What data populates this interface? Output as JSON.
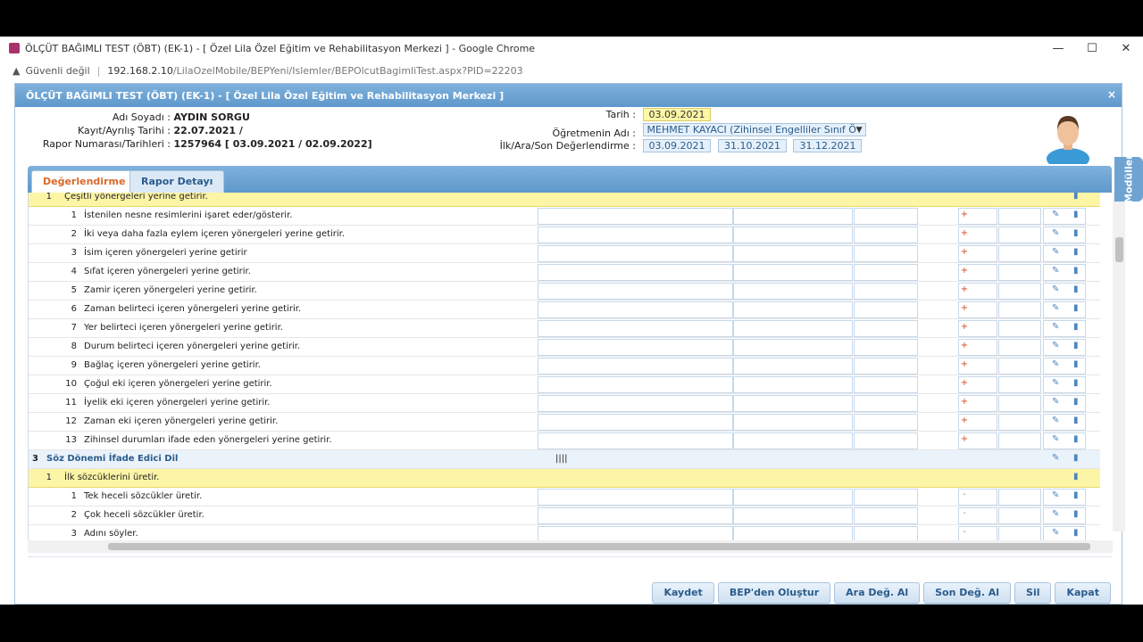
{
  "browser": {
    "window_title": "ÖLÇÜT BAĞIMLI TEST (ÖBT) (EK-1) - [ Özel Lila Özel Eğitim ve Rehabilitasyon Merkezi ] - Google Chrome",
    "security_label": "Güvenli değil",
    "url_host": "192.168.2.10",
    "url_path": "/LilaOzelMobile/BEPYeni/Islemler/BEPOlcutBagimliTest.aspx?PID=22203",
    "minimize": "—",
    "maximize": "☐",
    "close": "✕"
  },
  "modal": {
    "title": "ÖLÇÜT BAĞIMLI TEST (ÖBT) (EK-1) - [ Özel Lila Özel Eğitim ve Rehabilitasyon Merkezi ]",
    "close": "×"
  },
  "info": {
    "name_label": "Adı Soyadı :",
    "name_value": "AYDIN SORGU",
    "reg_label": "Kayıt/Ayrılış Tarihi :",
    "reg_value": "22.07.2021 /",
    "report_label": "Rapor Numarası/Tarihleri :",
    "report_value": "1257964 [ 03.09.2021 / 02.09.2022]",
    "date_label": "Tarih :",
    "date_value": "03.09.2021",
    "teacher_label": "Öğretmenin Adı :",
    "teacher_value": "MEHMET KAYACI (Zihinsel Engelliler Sınıf Ö",
    "eval_label": "İlk/Ara/Son Değerlendirme :",
    "eval_dates": [
      "03.09.2021",
      "31.10.2021",
      "31.12.2021"
    ]
  },
  "modules_tab": "Modüller",
  "tabs": [
    "Değerlendirme",
    "Rapor Detayı"
  ],
  "grid": {
    "top_partial_row": {
      "num": "1",
      "text": "Çeşitli yönergeleri yerine getirir."
    },
    "rows": [
      {
        "num": "1",
        "text": "İstenilen nesne resimlerini işaret eder/gösterir."
      },
      {
        "num": "2",
        "text": "İki veya daha fazla eylem içeren yönergeleri yerine getirir."
      },
      {
        "num": "3",
        "text": "İsim içeren yönergeleri yerine getirir"
      },
      {
        "num": "4",
        "text": "Sıfat içeren yönergeleri yerine getirir."
      },
      {
        "num": "5",
        "text": "Zamir içeren yönergeleri yerine getirir."
      },
      {
        "num": "6",
        "text": "Zaman belirteci içeren yönergeleri yerine getirir."
      },
      {
        "num": "7",
        "text": "Yer belirteci içeren yönergeleri yerine getirir."
      },
      {
        "num": "8",
        "text": "Durum belirteci içeren yönergeleri yerine getirir."
      },
      {
        "num": "9",
        "text": "Bağlaç içeren yönergeleri yerine getirir."
      },
      {
        "num": "10",
        "text": "Çoğul eki içeren yönergeleri yerine getirir."
      },
      {
        "num": "11",
        "text": "İyelik eki içeren yönergeleri yerine getirir."
      },
      {
        "num": "12",
        "text": "Zaman eki içeren yönergeleri yerine getirir."
      },
      {
        "num": "13",
        "text": "Zihinsel durumları ifade eden yönergeleri yerine getirir."
      }
    ],
    "section": {
      "num": "3",
      "text": "Söz Dönemi İfade Edici Dil",
      "marks": "||||"
    },
    "subsection": {
      "num": "1",
      "text": "İlk sözcüklerini üretir."
    },
    "sub_rows": [
      {
        "num": "1",
        "text": "Tek heceli sözcükler üretir."
      },
      {
        "num": "2",
        "text": "Çok heceli sözcükler üretir."
      },
      {
        "num": "3",
        "text": "Adını söyler."
      }
    ],
    "plus_symbol": "+",
    "dash_symbol": "-",
    "pencil_symbol": "✎",
    "trash_symbol": "🗑"
  },
  "buttons": [
    "Kaydet",
    "BEP'den Oluştur",
    "Ara Değ. Al",
    "Son Değ. Al",
    "Sil",
    "Kapat"
  ]
}
